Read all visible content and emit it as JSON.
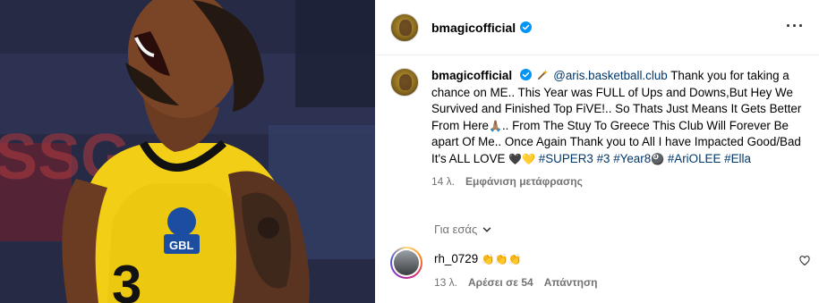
{
  "post": {
    "image_alt": "Basketball player in yellow ARIS jersey number 3 shouting"
  },
  "header": {
    "username": "bmagicofficial",
    "more_icon": "more-horizontal-icon",
    "more_label": "···"
  },
  "caption": {
    "username": "bmagicofficial",
    "mention": "@aris.basketball.club",
    "text_1": " Thank you for taking a chance on ME.. This Year was FULL of Ups and Downs,But Hey We Survived and Finished Top FiVE!.. So Thats Just Means It Gets Better From Here",
    "pray_emoji": "🙏🏽",
    "text_2": ".. From The Stuy To Greece This Club Will Forever Be apart Of Me.. Once Again Thank you to All I have Impacted Good/Bad It's ALL LOVE ",
    "hearts": "🖤💛",
    "tag_1": "#SUPER3",
    "tag_2": "#3",
    "tag_3": "#Year8",
    "ball_emoji": "🎱",
    "tag_4": "#AriOLEE",
    "tag_5": "#Ella",
    "time": "14 λ.",
    "see_translation": "Εμφάνιση μετάφρασης"
  },
  "for_you": {
    "label": "Για εσάς"
  },
  "comment": {
    "username": "rh_0729",
    "emoji": "👏👏👏",
    "time": "13 λ.",
    "likes": "Αρέσει σε 54",
    "reply": "Απάντηση"
  },
  "colors": {
    "link": "#00376b",
    "verified": "#0095f6",
    "secondary_text": "#737373",
    "jersey": "#f5d000"
  }
}
